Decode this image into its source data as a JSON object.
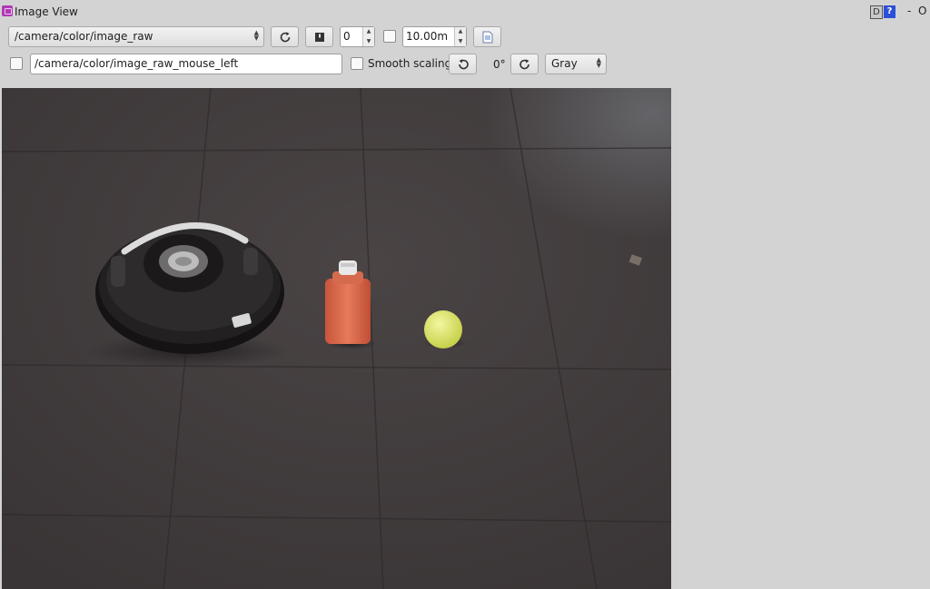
{
  "window": {
    "title": "Image View",
    "debug_badge": "D",
    "help_badge": "?",
    "minimize_label": "-",
    "close_label": "O"
  },
  "toolbar": {
    "topic": "/camera/color/image_raw",
    "refresh_icon": "refresh-icon",
    "save_icon": "save-icon",
    "frame_value": "0",
    "max_range_value": "10.00m",
    "fit_icon": "zoom-fit-icon"
  },
  "toolbar2": {
    "mouse_topic": "/camera/color/image_raw_mouse_left",
    "smooth_label": "Smooth scaling",
    "rotate_left_icon": "rotate-left-icon",
    "rotation_value": "0°",
    "rotate_right_icon": "rotate-right-icon",
    "colormap": "Gray"
  },
  "image": {
    "description_icon": "camera-image"
  }
}
